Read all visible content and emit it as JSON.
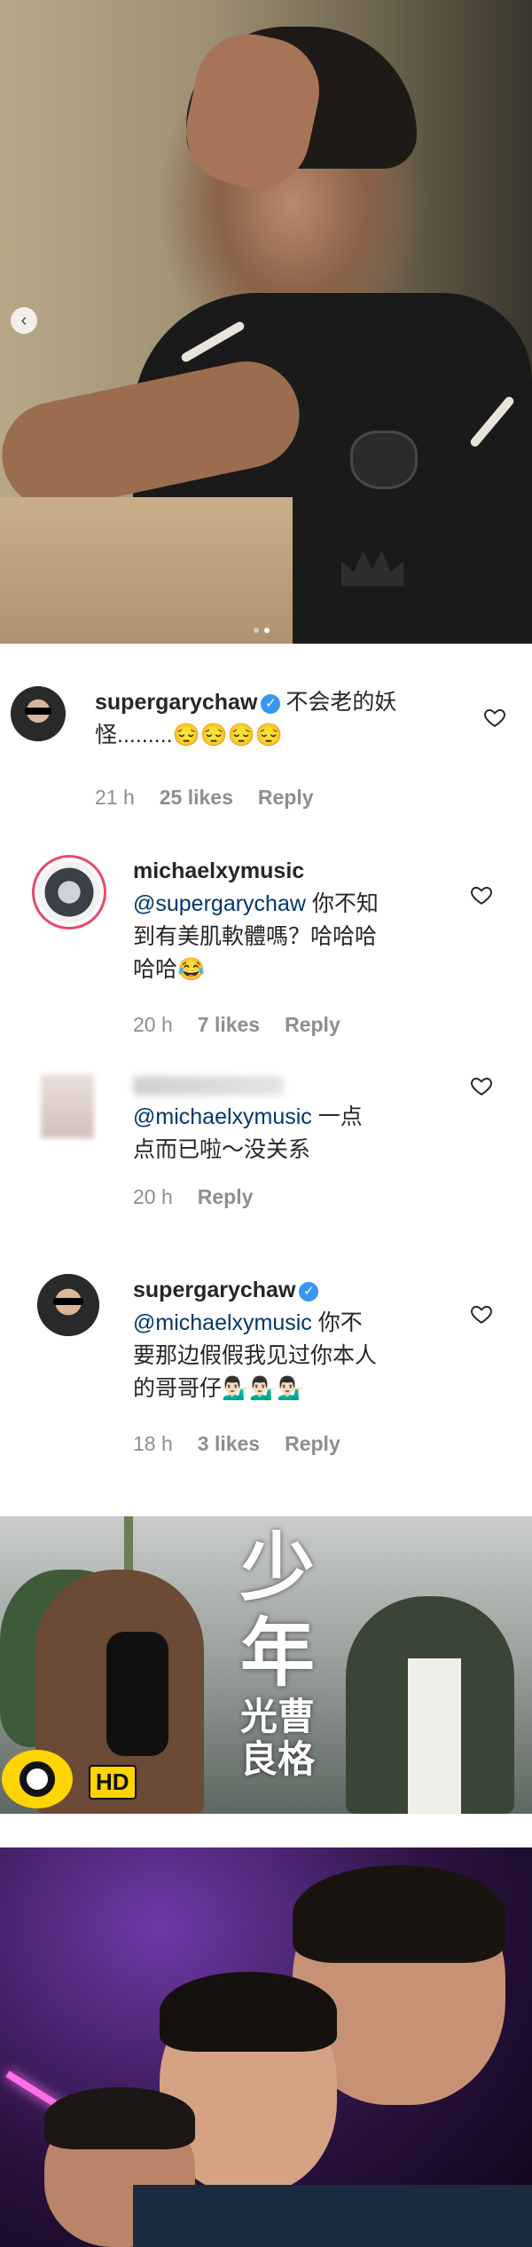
{
  "carousel": {
    "prev_icon": "chevron-left-icon",
    "slide_count": 2,
    "active_slide": 2
  },
  "comments": [
    {
      "username": "supergarychaw",
      "verified": true,
      "mention": "",
      "text_line1": "不会老的妖",
      "text_line2": "怪.........😔😔😔😔",
      "time": "21 h",
      "likes": "25 likes",
      "reply": "Reply"
    },
    {
      "username": "michaelxymusic",
      "verified": false,
      "mention": "@supergarychaw",
      "text_line1": " 你不知",
      "text_line2": "到有美肌軟體嗎？哈哈哈",
      "text_line3": "哈哈😂",
      "time": "20 h",
      "likes": "7 likes",
      "reply": "Reply"
    },
    {
      "username": "",
      "verified": false,
      "mention": "@michaelxymusic",
      "text_line1": " 一点",
      "text_line2": "点而已啦～没关系",
      "time": "20 h",
      "likes": "",
      "reply": "Reply"
    },
    {
      "username": "supergarychaw",
      "verified": true,
      "mention": "@michaelxymusic",
      "text_line1": " 你不",
      "text_line2": "要那边假假我见过你本人",
      "text_line3": "的哥哥仔💁🏻‍♂️💁🏻‍♂️💁🏻‍♂️",
      "time": "18 h",
      "likes": "3 likes",
      "reply": "Reply"
    }
  ],
  "video": {
    "title_big1": "少",
    "title_big2": "年",
    "title_small1": "光曹",
    "title_small2": "良格",
    "hd_badge": "HD"
  },
  "colors": {
    "mention": "#00376b",
    "verified": "#3897f0",
    "story_ring": "#e9486b"
  }
}
